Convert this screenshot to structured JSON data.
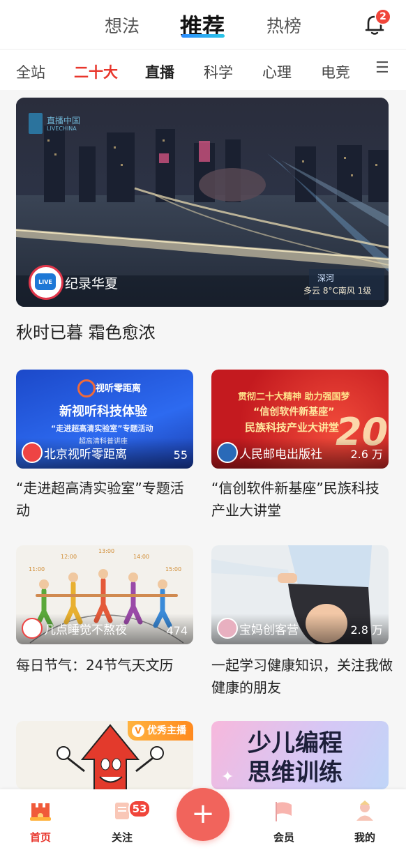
{
  "header": {
    "tabs": [
      {
        "label": "想法"
      },
      {
        "label": "推荐"
      },
      {
        "label": "热榜"
      }
    ],
    "notification_count": "2"
  },
  "categories": [
    "全站",
    "二十大",
    "直播",
    "科学",
    "心理",
    "电竞"
  ],
  "feature": {
    "author": "纪录华夏",
    "live_label": "LIVE",
    "watermark": "直播中国",
    "watermark_sub": "LIVECHINA",
    "weather_place": "深河",
    "weather_text": "多云 8°C南风 1级",
    "title": "秋时已暮 霜色愈浓"
  },
  "cards": [
    {
      "author": "北京视听零距离",
      "count": "55",
      "title": "“走进超高清实验室”专题活动",
      "img_brand": "视听零距离",
      "img_main": "新视听科技体验",
      "img_sub": "“走进超高清实验室”专题活动",
      "img_sub2": "超高清科普讲座"
    },
    {
      "author": "人民邮电出版社",
      "count": "2.6 万",
      "title": "“信创软件新基座”民族科技产业大讲堂",
      "img_line1": "贯彻二十大精神  助力强国梦",
      "img_line2": "“信创软件新基座”",
      "img_line3": "民族科技产业大讲堂",
      "img_big": "20"
    },
    {
      "author": "几点睡觉不熬夜",
      "count": "474",
      "title": "每日节气：24节气天文历",
      "img_times": [
        "11:00",
        "12:00",
        "13:00",
        "14:00",
        "15:00"
      ]
    },
    {
      "author": "宝妈创客营",
      "count": "2.8 万",
      "title": "一起学习健康知识，关注我做健康的朋友"
    },
    {
      "badge": "优秀主播"
    },
    {
      "img_line1": "少儿编程",
      "img_line2": "思维训练"
    }
  ],
  "bottom_nav": [
    {
      "label": "首页"
    },
    {
      "label": "关注",
      "badge": "53"
    },
    {
      "label": "+"
    },
    {
      "label": "会员"
    },
    {
      "label": "我的"
    }
  ],
  "colors": {
    "accent": "#e8362c",
    "plus": "#f1645c",
    "tab_underline": "#2d8cff"
  }
}
